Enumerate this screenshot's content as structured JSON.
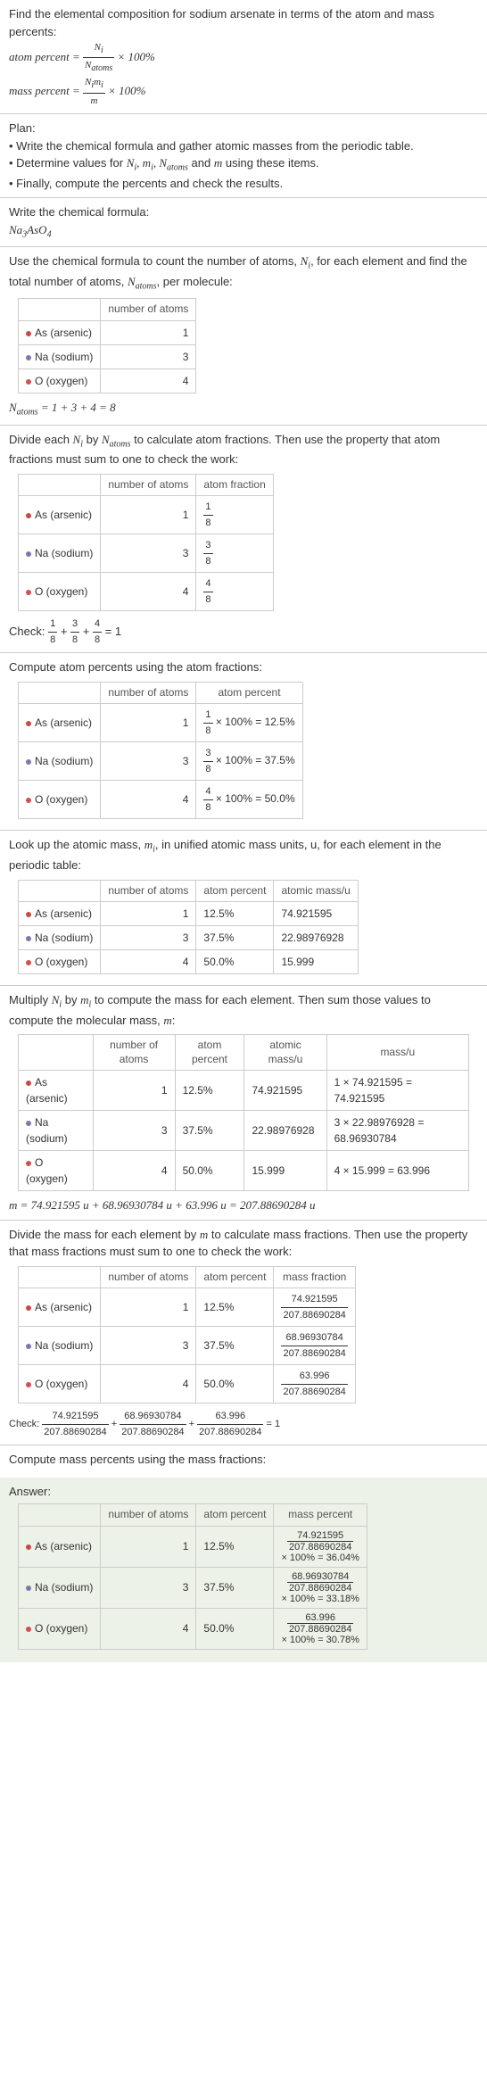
{
  "intro": {
    "l1": "Find the elemental composition for sodium arsenate in terms of the atom and mass percents:",
    "ap": "atom percent =",
    "mp": "mass percent =",
    "t100": "× 100%",
    "Ni": "N",
    "i": "i",
    "Natoms": "N",
    "atoms": "atoms",
    "Nimi": "N",
    "mi": "m",
    "m": "m"
  },
  "plan": {
    "h": "Plan:",
    "b1": "• Write the chemical formula and gather atomic masses from the periodic table.",
    "b2": "• Determine values for ",
    "b2b": " using these items.",
    "b3": "• Finally, compute the percents and check the results."
  },
  "s1": {
    "l1": "Write the chemical formula:",
    "f": "Na",
    "f3": "3",
    "fAs": "AsO",
    "f4": "4"
  },
  "s2": {
    "l1": "Use the chemical formula to count the number of atoms, ",
    "l1b": ", for each element and find the total number of atoms, ",
    "l1c": ", per molecule:",
    "th2": "number of atoms",
    "r1": "As (arsenic)",
    "v1": "1",
    "r2": "Na (sodium)",
    "v2": "3",
    "r3": "O (oxygen)",
    "v3": "4",
    "eq": " = 1 + 3 + 4 = 8"
  },
  "s3": {
    "l1": "Divide each ",
    "l1b": " by ",
    "l1c": " to calculate atom fractions. Then use the property that atom fractions must sum to one to check the work:",
    "th3": "atom fraction",
    "f1n": "1",
    "f2n": "3",
    "f3n": "4",
    "fd": "8",
    "chk": "Check: ",
    "chkr": " = 1"
  },
  "s4": {
    "l1": "Compute atom percents using the atom fractions:",
    "th3": "atom percent",
    "r1": "× 100% = 12.5%",
    "r2": "× 100% = 37.5%",
    "r3": "× 100% = 50.0%"
  },
  "s5": {
    "l1": "Look up the atomic mass, ",
    "l1b": ", in unified atomic mass units, u, for each element in the periodic table:",
    "th3": "atom percent",
    "th4": "atomic mass/u",
    "p1": "12.5%",
    "p2": "37.5%",
    "p3": "50.0%",
    "m1": "74.921595",
    "m2": "22.98976928",
    "m3": "15.999"
  },
  "s6": {
    "l1": "Multiply ",
    "l1b": " by ",
    "l1c": " to compute the mass for each element. Then sum those values to compute the molecular mass, ",
    "l1d": ":",
    "th5": "mass/u",
    "c1": "1 × 74.921595 = 74.921595",
    "c2": "3 × 22.98976928 = 68.96930784",
    "c3": "4 × 15.999 = 63.996",
    "eq": " = 74.921595 u + 68.96930784 u + 63.996 u = 207.88690284 u"
  },
  "s7": {
    "l1": "Divide the mass for each element by ",
    "l1b": " to calculate mass fractions. Then use the property that mass fractions must sum to one to check the work:",
    "th5": "mass fraction",
    "md": "207.88690284",
    "n1": "74.921595",
    "n2": "68.96930784",
    "n3": "63.996"
  },
  "s8": {
    "l1": "Compute mass percents using the mass fractions:",
    "ans": "Answer:",
    "th5": "mass percent",
    "r1": "× 100% = 36.04%",
    "r2": "× 100% = 33.18%",
    "r3": "× 100% = 30.78%"
  },
  "labels": {
    "and": " and "
  }
}
